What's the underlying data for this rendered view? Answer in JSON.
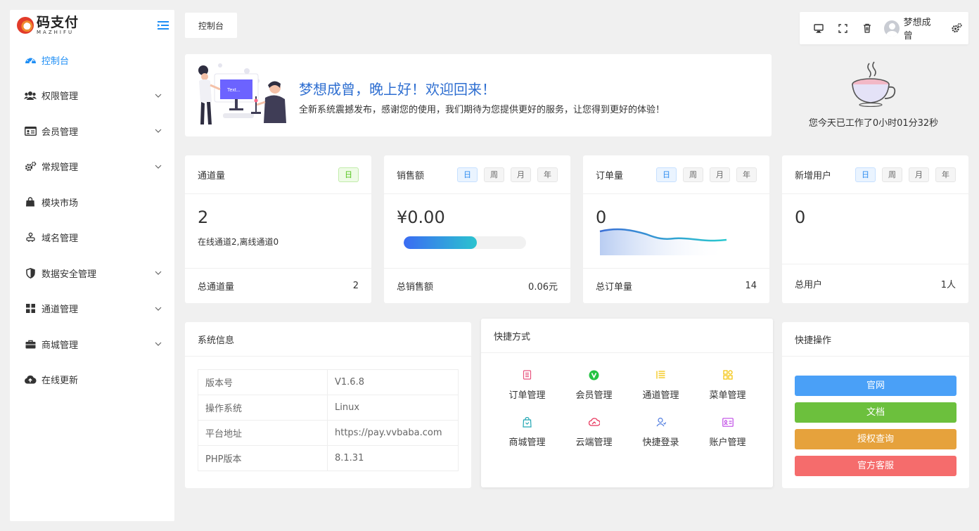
{
  "brand": {
    "name": "码支付",
    "sub": "MAZHIFU"
  },
  "sidebar": {
    "items": [
      {
        "label": "控制台",
        "icon": "dashboard-icon",
        "active": true,
        "chevron": false
      },
      {
        "label": "权限管理",
        "icon": "users-icon",
        "active": false,
        "chevron": true
      },
      {
        "label": "会员管理",
        "icon": "id-card-icon",
        "active": false,
        "chevron": true
      },
      {
        "label": "常规管理",
        "icon": "gears-icon",
        "active": false,
        "chevron": true
      },
      {
        "label": "模块市场",
        "icon": "shopping-bag-icon",
        "active": false,
        "chevron": false
      },
      {
        "label": "域名管理",
        "icon": "domain-icon",
        "active": false,
        "chevron": false
      },
      {
        "label": "数据安全管理",
        "icon": "shield-icon",
        "active": false,
        "chevron": true
      },
      {
        "label": "通道管理",
        "icon": "grid-icon",
        "active": false,
        "chevron": true
      },
      {
        "label": "商城管理",
        "icon": "briefcase-icon",
        "active": false,
        "chevron": true
      },
      {
        "label": "在线更新",
        "icon": "cloud-upload-icon",
        "active": false,
        "chevron": false
      }
    ]
  },
  "breadcrumb": {
    "label": "控制台"
  },
  "toolbar": {
    "username": "梦想成曾"
  },
  "welcome": {
    "title": "梦想成曾，晚上好！欢迎回来！",
    "subtitle": "全新系统震撼发布，感谢您的使用，我们期待为您提供更好的服务，让您得到更好的体验！",
    "screen_text": "Text..."
  },
  "worktime": {
    "text": "您今天已工作了0小时01分32秒"
  },
  "stats": {
    "channels": {
      "title": "通道量",
      "pills": [
        "日"
      ],
      "value": "2",
      "desc": "在线通道2,离线通道0",
      "foot_label": "总通道量",
      "foot_value": "2"
    },
    "sales": {
      "title": "销售额",
      "pills": [
        "日",
        "周",
        "月",
        "年"
      ],
      "value": "¥0.00",
      "progress": 0.6,
      "foot_label": "总销售额",
      "foot_value": "0.06元"
    },
    "orders": {
      "title": "订单量",
      "pills": [
        "日",
        "周",
        "月",
        "年"
      ],
      "value": "0",
      "foot_label": "总订单量",
      "foot_value": "14"
    },
    "users": {
      "title": "新增用户",
      "pills": [
        "日",
        "周",
        "月",
        "年"
      ],
      "value": "0",
      "foot_label": "总用户",
      "foot_value": "1人"
    }
  },
  "sysinfo": {
    "title": "系统信息",
    "rows": [
      {
        "k": "版本号",
        "v": "V1.6.8"
      },
      {
        "k": "操作系统",
        "v": "Linux"
      },
      {
        "k": "平台地址",
        "v": "https://pay.vvbaba.com"
      },
      {
        "k": "PHP版本",
        "v": "8.1.31"
      }
    ]
  },
  "shortcuts": {
    "title": "快捷方式",
    "items": [
      {
        "label": "订单管理",
        "icon": "order-list-icon",
        "color": "#e8557f"
      },
      {
        "label": "会员管理",
        "icon": "vip-icon",
        "color": "#23c343"
      },
      {
        "label": "通道管理",
        "icon": "list-icon",
        "color": "#f2c100"
      },
      {
        "label": "菜单管理",
        "icon": "menu-blocks-icon",
        "color": "#f2c100"
      },
      {
        "label": "商城管理",
        "icon": "shop-bag-icon",
        "color": "#22a6b3"
      },
      {
        "label": "云端管理",
        "icon": "cloud-icon",
        "color": "#e8335a"
      },
      {
        "label": "快捷登录",
        "icon": "user-login-icon",
        "color": "#4f7ce0"
      },
      {
        "label": "账户管理",
        "icon": "account-card-icon",
        "color": "#c04ce6"
      }
    ]
  },
  "quickops": {
    "title": "快捷操作",
    "buttons": [
      {
        "label": "官网",
        "color": "#4aa0f7"
      },
      {
        "label": "文档",
        "color": "#6cc03d"
      },
      {
        "label": "授权查询",
        "color": "#e6a23c"
      },
      {
        "label": "官方客服",
        "color": "#f56c6c"
      }
    ]
  }
}
